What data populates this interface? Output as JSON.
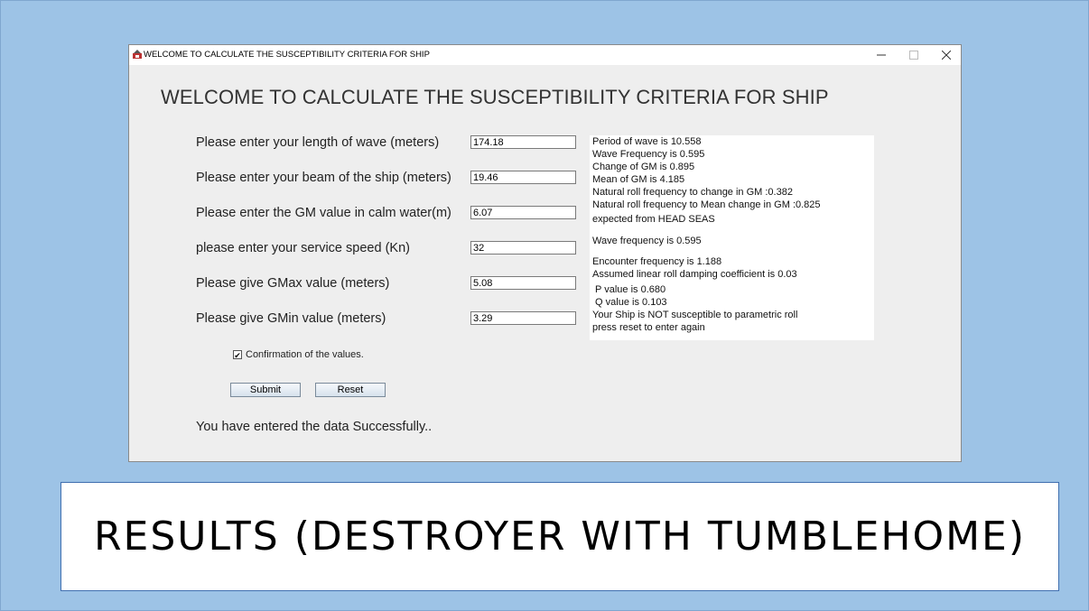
{
  "window": {
    "title": "WELCOME TO CALCULATE THE SUSCEPTIBILITY CRITERIA FOR SHIP",
    "minimize_glyph": "−",
    "maximize_glyph": "□",
    "close_glyph": "✕"
  },
  "heading": "WELCOME TO CALCULATE THE SUSCEPTIBILITY CRITERIA FOR SHIP",
  "form": {
    "fields": [
      {
        "label": "Please enter your length of wave (meters)",
        "value": "174.18"
      },
      {
        "label": "Please enter your beam of the ship (meters)",
        "value": "19.46"
      },
      {
        "label": "Please enter the GM value in calm water(m)",
        "value": "6.07"
      },
      {
        "label": "please enter your service speed (Kn)",
        "value": "32"
      },
      {
        "label": "Please give GMax value (meters)",
        "value": "5.08"
      },
      {
        "label": "Please give GMin value (meters)",
        "value": "3.29"
      }
    ],
    "confirm_label": "Confirmation of the values.",
    "confirm_checked": true,
    "submit_label": "Submit",
    "reset_label": "Reset",
    "status": "You have entered the data Successfully.."
  },
  "results": [
    "Period of wave is 10.558",
    "Wave Frequency is 0.595",
    "Change of GM is 0.895",
    "Mean of GM is 4.185",
    "Natural roll frequency to change in GM :0.382",
    "Natural roll frequency to Mean change in GM :0.825",
    "expected from HEAD SEAS",
    "Wave frequency is 0.595",
    "Encounter frequency is 1.188",
    "Assumed linear roll damping coefficient is 0.03",
    " P value is 0.680",
    " Q value is 0.103",
    "Your Ship is NOT susceptible to parametric roll",
    "press reset to enter again"
  ],
  "caption": "RESULTS (DESTROYER WITH TUMBLEHOME)",
  "colors": {
    "slide_background": "#9dc3e6",
    "window_background": "#eeeeee",
    "caption_border": "#3f6fb0"
  }
}
